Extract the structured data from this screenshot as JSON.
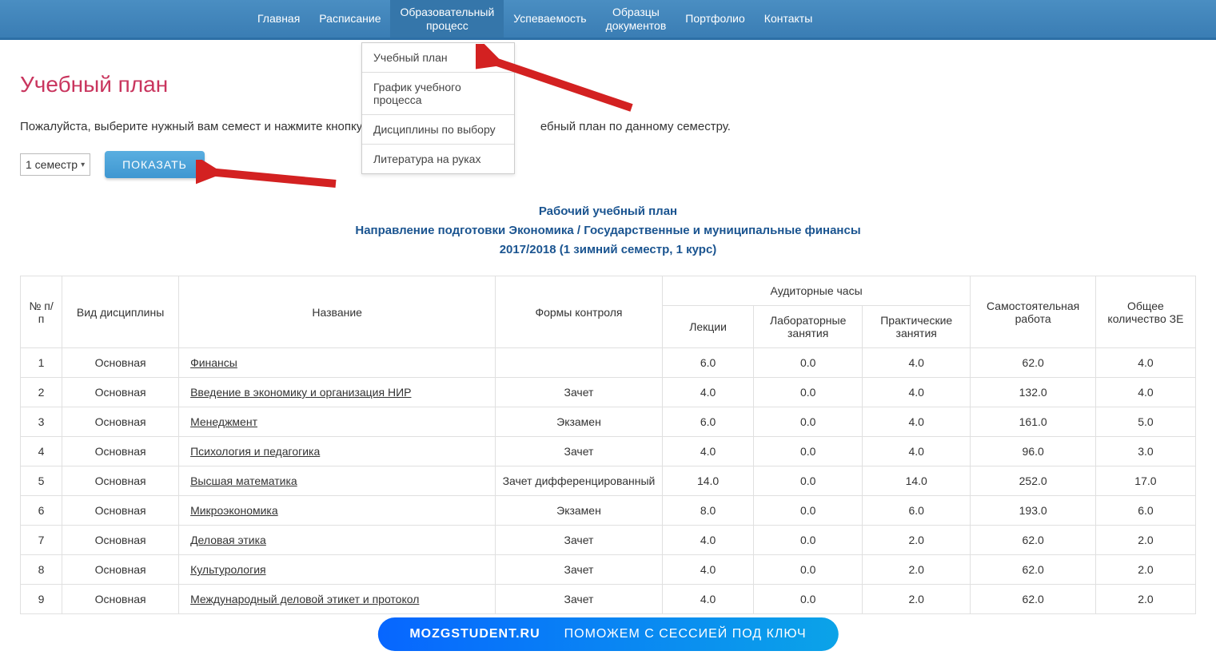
{
  "nav": {
    "items": [
      {
        "label1": "Главная"
      },
      {
        "label1": "Расписание"
      },
      {
        "label1": "Образовательный",
        "label2": "процесс"
      },
      {
        "label1": "Успеваемость"
      },
      {
        "label1": "Образцы",
        "label2": "документов"
      },
      {
        "label1": "Портфолио"
      },
      {
        "label1": "Контакты"
      }
    ],
    "dropdown": [
      "Учебный план",
      "График учебного процесса",
      "Дисциплины по выбору",
      "Литература на руках"
    ]
  },
  "page": {
    "title": "Учебный план",
    "instruction_before": "Пожалуйста, выберите нужный вам семест и нажмите кнопку \"показа",
    "instruction_after": "ебный план по данному семестру.",
    "semester_selected": "1 семестр",
    "show_button": "ПОКАЗАТЬ"
  },
  "plan_header": {
    "line1": "Рабочий учебный план",
    "line2": "Направление подготовки Экономика / Государственные и муниципальные финансы",
    "line3": "2017/2018 (1 зимний семестр, 1 курс)"
  },
  "table": {
    "headers": {
      "num": "№ п/п",
      "type": "Вид дисциплины",
      "name": "Название",
      "control": "Формы контроля",
      "audit_group": "Аудиторные часы",
      "lectures": "Лекции",
      "lab": "Лабораторные занятия",
      "practice": "Практические занятия",
      "self": "Самостоятельная работа",
      "total": "Общее количество ЗЕ"
    },
    "rows": [
      {
        "num": "1",
        "type": "Основная",
        "name": "Финансы",
        "control": "",
        "lectures": "6.0",
        "lab": "0.0",
        "practice": "4.0",
        "self": "62.0",
        "total": "4.0"
      },
      {
        "num": "2",
        "type": "Основная",
        "name": "Введение в экономику и организация НИР",
        "control": "Зачет",
        "lectures": "4.0",
        "lab": "0.0",
        "practice": "4.0",
        "self": "132.0",
        "total": "4.0"
      },
      {
        "num": "3",
        "type": "Основная",
        "name": "Менеджмент",
        "control": "Экзамен",
        "lectures": "6.0",
        "lab": "0.0",
        "practice": "4.0",
        "self": "161.0",
        "total": "5.0"
      },
      {
        "num": "4",
        "type": "Основная",
        "name": "Психология и педагогика",
        "control": "Зачет",
        "lectures": "4.0",
        "lab": "0.0",
        "practice": "4.0",
        "self": "96.0",
        "total": "3.0"
      },
      {
        "num": "5",
        "type": "Основная",
        "name": "Высшая математика",
        "control": "Зачет дифференцированный",
        "lectures": "14.0",
        "lab": "0.0",
        "practice": "14.0",
        "self": "252.0",
        "total": "17.0"
      },
      {
        "num": "6",
        "type": "Основная",
        "name": "Микроэкономика",
        "control": "Экзамен",
        "lectures": "8.0",
        "lab": "0.0",
        "practice": "6.0",
        "self": "193.0",
        "total": "6.0"
      },
      {
        "num": "7",
        "type": "Основная",
        "name": "Деловая этика",
        "control": "Зачет",
        "lectures": "4.0",
        "lab": "0.0",
        "practice": "2.0",
        "self": "62.0",
        "total": "2.0"
      },
      {
        "num": "8",
        "type": "Основная",
        "name": "Культурология",
        "control": "Зачет",
        "lectures": "4.0",
        "lab": "0.0",
        "practice": "2.0",
        "self": "62.0",
        "total": "2.0"
      },
      {
        "num": "9",
        "type": "Основная",
        "name": "Международный деловой этикет и протокол",
        "control": "Зачет",
        "lectures": "4.0",
        "lab": "0.0",
        "practice": "2.0",
        "self": "62.0",
        "total": "2.0"
      }
    ]
  },
  "footer": {
    "brand": "MOZGSTUDENT.RU",
    "tagline": "ПОМОЖЕМ С СЕССИЕЙ ПОД КЛЮЧ"
  }
}
